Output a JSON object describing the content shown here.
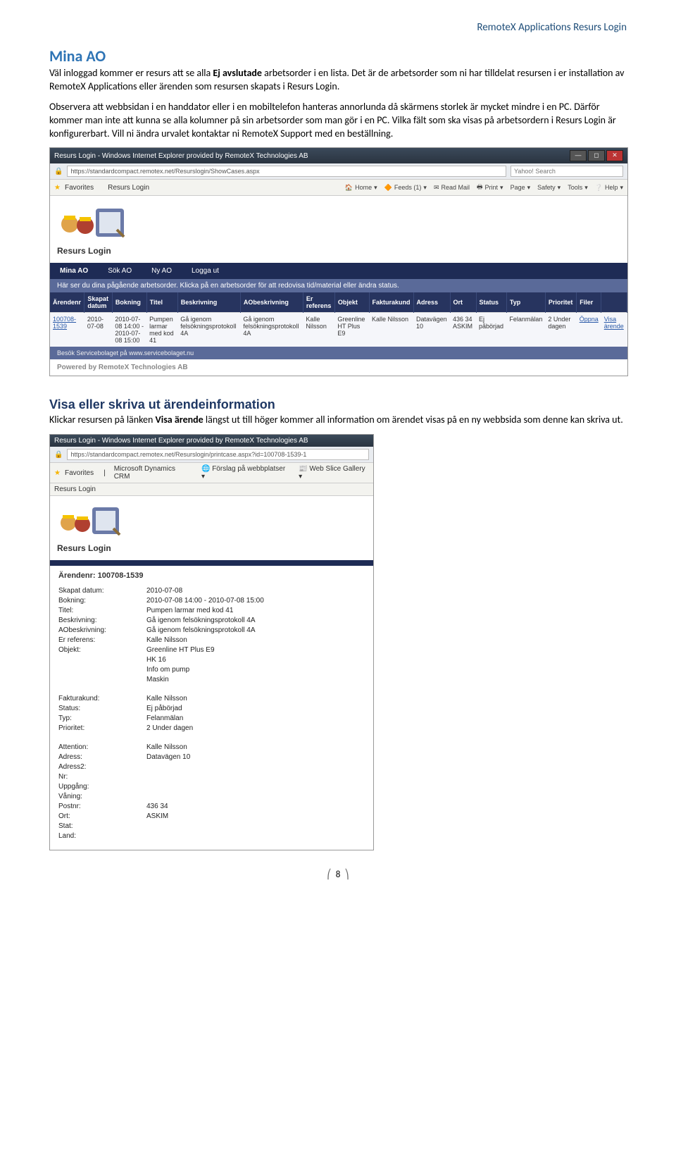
{
  "header": {
    "title": "RemoteX Applications Resurs Login"
  },
  "s1": {
    "heading": "Mina AO",
    "para1_a": "Väl inloggad kommer er resurs att se alla ",
    "para1_b": "Ej avslutade",
    "para1_c": " arbetsorder i en lista. Det är de arbetsorder som ni har tilldelat resursen i er installation av RemoteX Applications eller ärenden som resursen skapats i Resurs Login.",
    "para2": "Observera att webbsidan i en handdator eller i en mobiltelefon hanteras annorlunda då skärmens storlek är mycket mindre i en PC. Därför kommer man inte att kunna se alla kolumner på sin arbetsorder som man gör i en PC. Vilka fält som ska visas på arbetsordern i Resurs Login är konfigurerbart. Vill ni ändra urvalet kontaktar ni RemoteX Support med en beställning."
  },
  "shot1": {
    "title": "Resurs Login - Windows Internet Explorer provided by RemoteX Technologies AB",
    "url": "https://standardcompact.remotex.net/Resurslogin/ShowCases.aspx",
    "search_placeholder": "Yahoo! Search",
    "fav_label": "Favorites",
    "tab_label": "Resurs Login",
    "menu": {
      "home": "Home",
      "feeds": "Feeds (1)",
      "readmail": "Read Mail",
      "print": "Print",
      "page": "Page",
      "safety": "Safety",
      "tools": "Tools",
      "help": "Help"
    },
    "app_label": "Resurs Login",
    "nav": [
      "Mina AO",
      "Sök AO",
      "Ny AO",
      "Logga ut"
    ],
    "instr": "Här ser du dina pågående arbetsorder. Klicka på en arbetsorder för att redovisa tid/material eller ändra status.",
    "columns": [
      "Ärendenr",
      "Skapat datum",
      "Bokning",
      "Titel",
      "Beskrivning",
      "AObeskrivning",
      "Er referens",
      "Objekt",
      "Fakturakund",
      "Adress",
      "Ort",
      "Status",
      "Typ",
      "Prioritet",
      "Filer",
      ""
    ],
    "row": {
      "arendenr": "100708-1539",
      "skapat": "2010-07-08",
      "bokning": "2010-07-08 14:00 - 2010-07-08 15:00",
      "titel": "Pumpen larmar med kod 41",
      "beskr": "Gå igenom felsökningsprotokoll 4A",
      "aobeskr": "Gå igenom felsökningsprotokoll 4A",
      "erref": "Kalle Nilsson",
      "objekt": "Greenline HT Plus E9",
      "fkund": "Kalle Nilsson",
      "adress": "Datavägen 10",
      "ort": "436 34 ASKIM",
      "status": "Ej påbörjad",
      "typ": "Felanmälan",
      "prio": "2 Under dagen",
      "filer": "Öppna",
      "visa": "Visa ärende"
    },
    "footer": "Besök Servicebolaget på www.servicebolaget.nu",
    "powered": "Powered by RemoteX Technologies AB"
  },
  "s2": {
    "heading": "Visa eller skriva ut ärendeinformation",
    "para_a": "Klickar resursen på länken ",
    "para_b": "Visa ärende",
    "para_c": " längst ut till höger kommer all information om ärendet visas på en ny webbsida som denne kan skriva ut."
  },
  "shot2": {
    "title": "Resurs Login - Windows Internet Explorer provided by RemoteX Technologies AB",
    "url": "https://standardcompact.remotex.net/Resurslogin/printcase.aspx?id=100708-1539-1",
    "fav_items": [
      "Microsoft Dynamics CRM",
      "Förslag på webbplatser",
      "Web Slice Gallery"
    ],
    "tab_label": "Resurs Login",
    "app_label": "Resurs Login",
    "arnr_label": "Ärendenr: ",
    "arnr": "100708-1539",
    "fields": [
      [
        "Skapat datum:",
        "2010-07-08"
      ],
      [
        "Bokning:",
        "2010-07-08 14:00 - 2010-07-08 15:00"
      ],
      [
        "Titel:",
        "Pumpen larmar med kod 41"
      ],
      [
        "Beskrivning:",
        "Gå igenom felsökningsprotokoll 4A"
      ],
      [
        "AObeskrivning:",
        "Gå igenom felsökningsprotokoll 4A"
      ],
      [
        "Er referens:",
        "Kalle Nilsson"
      ],
      [
        "Objekt:",
        "Greenline HT Plus E9"
      ],
      [
        "",
        "HK 16"
      ],
      [
        "",
        "Info om pump"
      ],
      [
        "",
        "Maskin"
      ],
      [
        "__SEP__",
        ""
      ],
      [
        "Fakturakund:",
        "Kalle Nilsson"
      ],
      [
        "Status:",
        "Ej påbörjad"
      ],
      [
        "Typ:",
        "Felanmälan"
      ],
      [
        "Prioritet:",
        "2 Under dagen"
      ],
      [
        "__SEP__",
        ""
      ],
      [
        "Attention:",
        "Kalle Nilsson"
      ],
      [
        "Adress:",
        "Datavägen 10"
      ],
      [
        "Adress2:",
        ""
      ],
      [
        "Nr:",
        ""
      ],
      [
        "Uppgång:",
        ""
      ],
      [
        "Våning:",
        ""
      ],
      [
        "Postnr:",
        "436 34"
      ],
      [
        "Ort:",
        "ASKIM"
      ],
      [
        "Stat:",
        ""
      ],
      [
        "Land:",
        ""
      ]
    ]
  },
  "page_number": "8"
}
